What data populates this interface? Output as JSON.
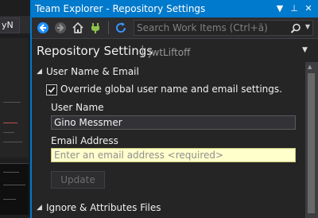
{
  "background": {
    "tab_label": "yN"
  },
  "window": {
    "title": "Team Explorer - Repository Settings",
    "controls": {
      "dropdown": "▼",
      "pin": "⊥",
      "close": "✕"
    }
  },
  "toolbar": {
    "search_placeholder": "Search Work Items (Ctrl+ä)"
  },
  "header": {
    "title": "Repository Settings",
    "separator": "|",
    "subtitle": "JwtLiftoff"
  },
  "sections": {
    "user": {
      "label": "User Name & Email",
      "override_label": "Override global user name and email settings.",
      "override_checked": true,
      "username_label": "User Name",
      "username_value": "Gino Messmer",
      "email_label": "Email Address",
      "email_placeholder": "Enter an email address <required>",
      "update_label": "Update"
    },
    "ignore": {
      "label": "Ignore & Attributes Files"
    }
  },
  "colors": {
    "accent": "#007acc",
    "email_field_bg": "#ffffcc",
    "background": "#252526"
  }
}
